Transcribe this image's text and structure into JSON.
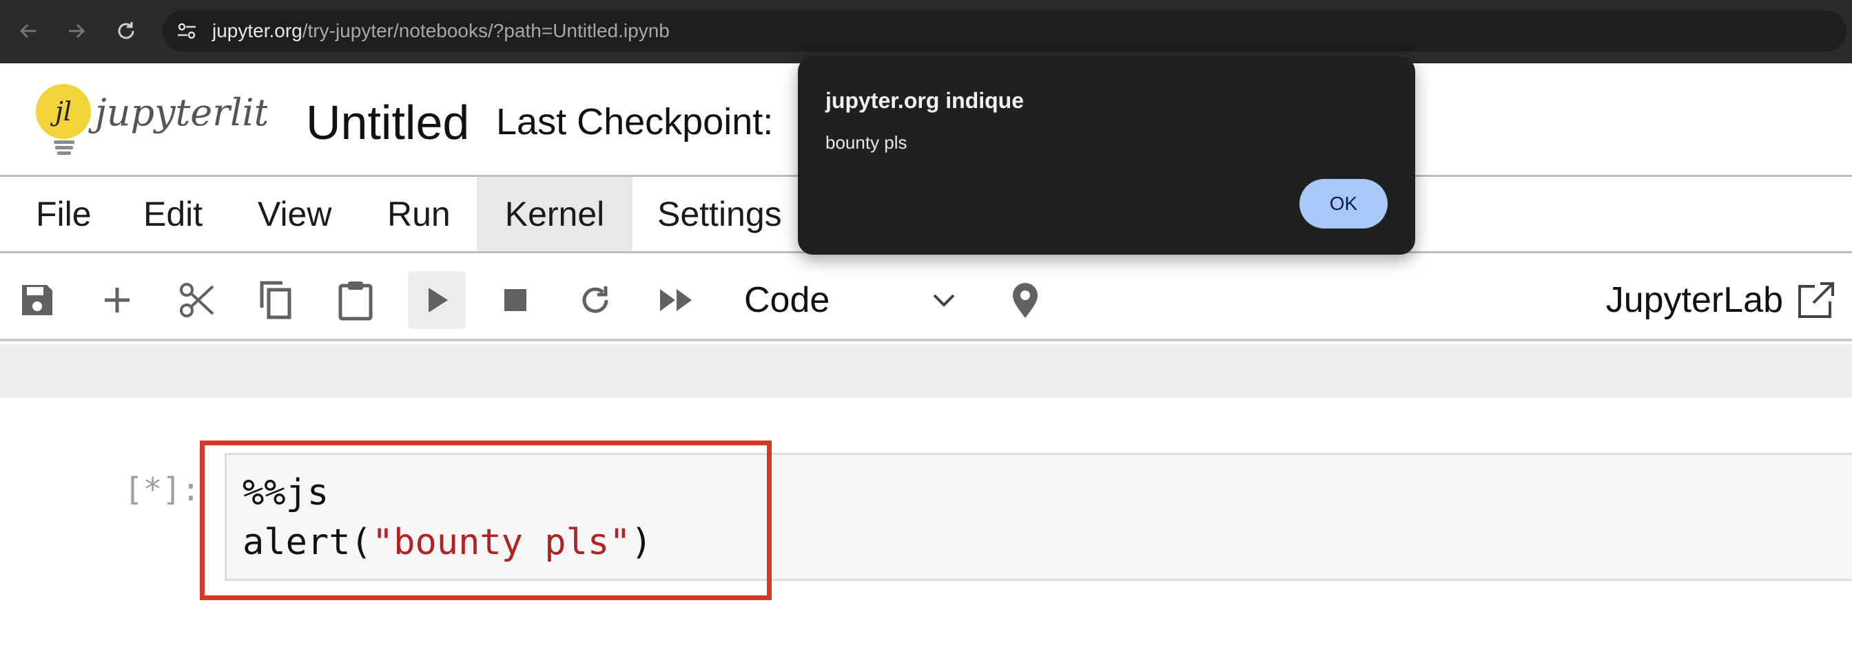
{
  "browser": {
    "url_host": "jupyter.org",
    "url_path": "/try-jupyter/notebooks/?path=Untitled.ipynb"
  },
  "header": {
    "logo_text": "jupyterlite",
    "logo_mark": "jl",
    "title": "Untitled",
    "checkpoint": "Last Checkpoint:"
  },
  "menu": {
    "items": [
      "File",
      "Edit",
      "View",
      "Run",
      "Kernel",
      "Settings"
    ],
    "active": "Kernel"
  },
  "toolbar": {
    "cell_type": "Code",
    "jupyterlab_label": "JupyterLab",
    "buttons": [
      "save-icon",
      "plus-icon",
      "scissors-icon",
      "copy-icon",
      "paste-icon",
      "play-icon",
      "stop-icon",
      "restart-icon",
      "fast-forward-icon"
    ]
  },
  "cell": {
    "prompt": "[*]:",
    "line1": "%%js",
    "line2_prefix": "alert(",
    "line2_string": "\"bounty pls\"",
    "line2_suffix": ")"
  },
  "dialog": {
    "title": "jupyter.org indique",
    "message": "bounty pls",
    "ok_label": "OK"
  },
  "colors": {
    "browser_bar": "#2b2b2b",
    "highlight_border": "#d23a24",
    "ok_button": "#a8c7fa",
    "code_string": "#b22222",
    "logo_yellow": "#f2d33a"
  }
}
